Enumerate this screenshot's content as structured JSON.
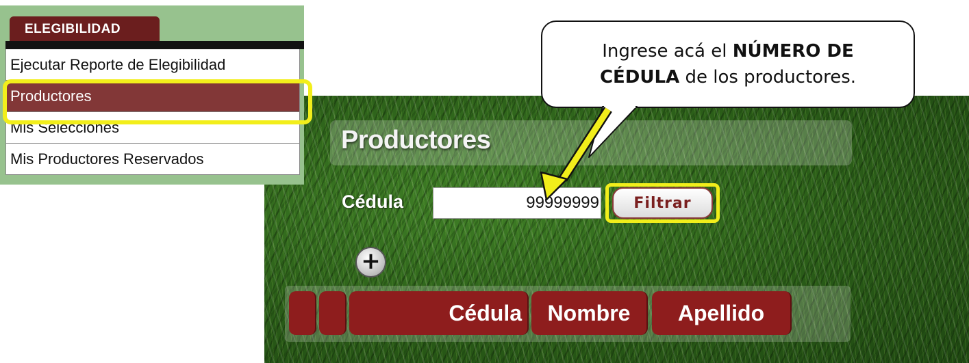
{
  "menu": {
    "tab_label": "ELEGIBILIDAD",
    "items": [
      {
        "label": "Ejecutar Reporte de Elegibilidad",
        "active": false
      },
      {
        "label": "Productores",
        "active": true
      },
      {
        "label": "Mis Selecciones",
        "active": false
      },
      {
        "label": "Mis Productores Reservados",
        "active": false
      }
    ]
  },
  "callout": {
    "line1_pre": "Ingrese acá el ",
    "line1_bold": "NÚMERO DE",
    "line2_bold": "CÉDULA",
    "line2_post": " de los productores."
  },
  "page": {
    "title": "Productores",
    "cedula_label": "Cédula",
    "cedula_value": "99999999",
    "filter_button": "Filtrar",
    "add_button": "+"
  },
  "table": {
    "columns": [
      "",
      "",
      "Cédula",
      "Nombre",
      "Apellido"
    ]
  },
  "colors": {
    "highlight": "#f2ee1b",
    "maroon": "#8e1d1d",
    "menu_bg": "#97c28e",
    "active_item": "#823737"
  }
}
